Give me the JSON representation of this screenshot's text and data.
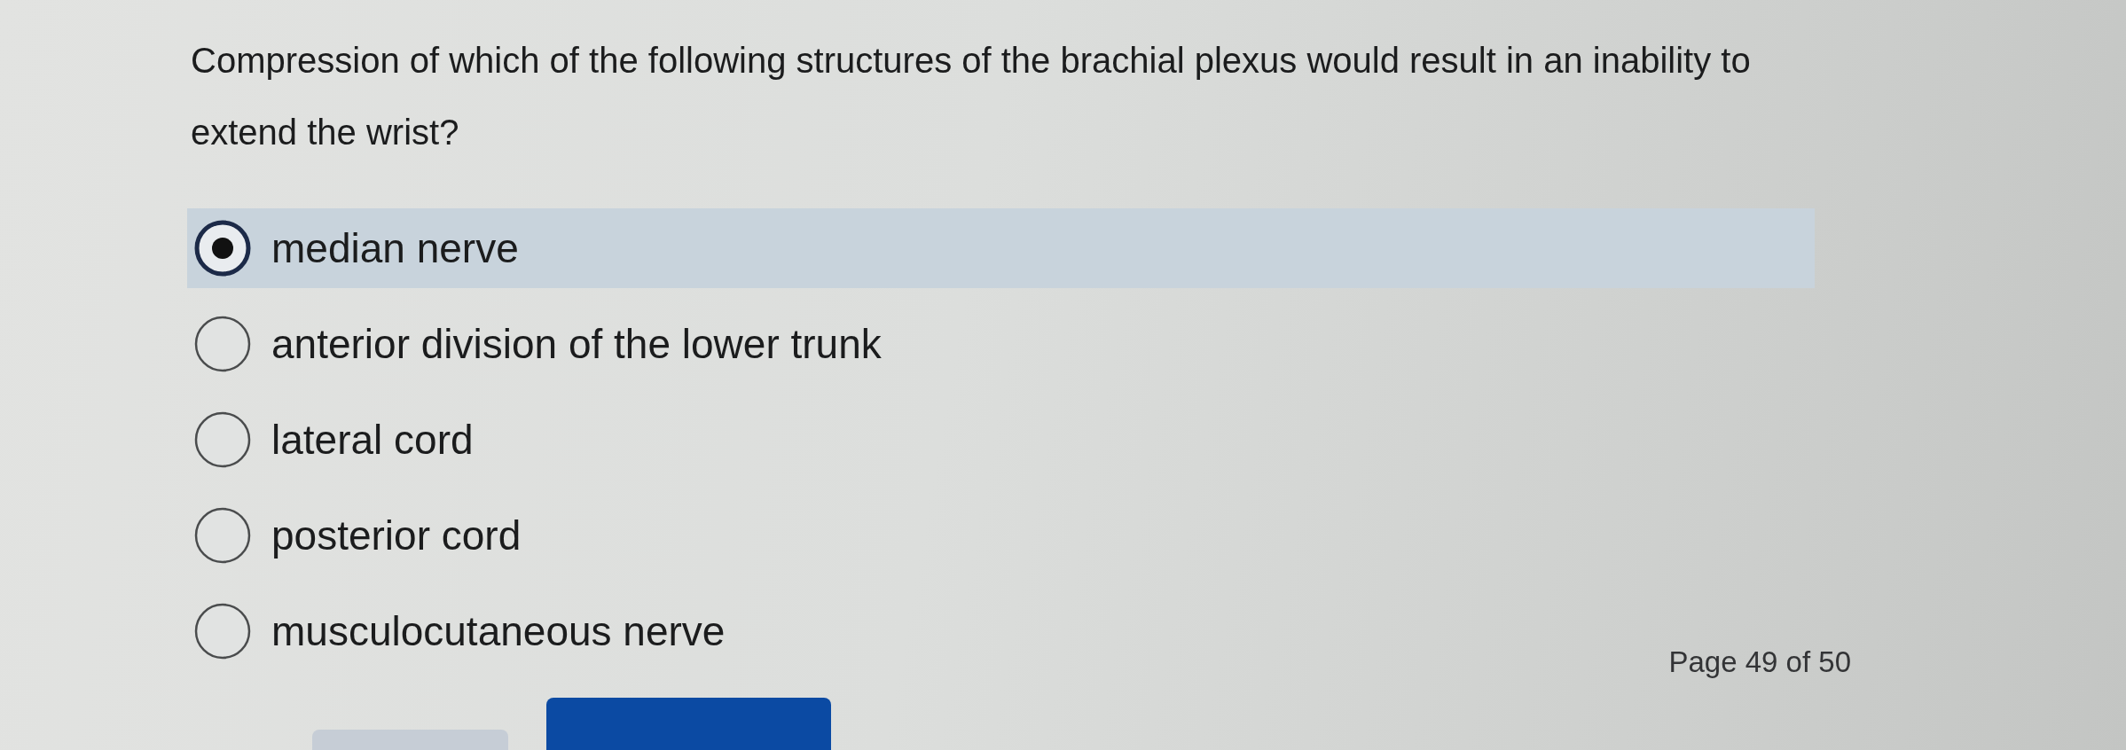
{
  "question": {
    "text": "Compression of which of the following structures of the brachial plexus would result in an inability to extend the wrist?"
  },
  "options": [
    {
      "label": "median nerve",
      "selected": true
    },
    {
      "label": "anterior division of the lower trunk",
      "selected": false
    },
    {
      "label": "lateral cord",
      "selected": false
    },
    {
      "label": "posterior cord",
      "selected": false
    },
    {
      "label": "musculocutaneous nerve",
      "selected": false
    }
  ],
  "page_indicator": {
    "text": "Page 49 of 50"
  },
  "buttons": [
    {
      "kind": "secondary"
    },
    {
      "kind": "primary"
    }
  ]
}
